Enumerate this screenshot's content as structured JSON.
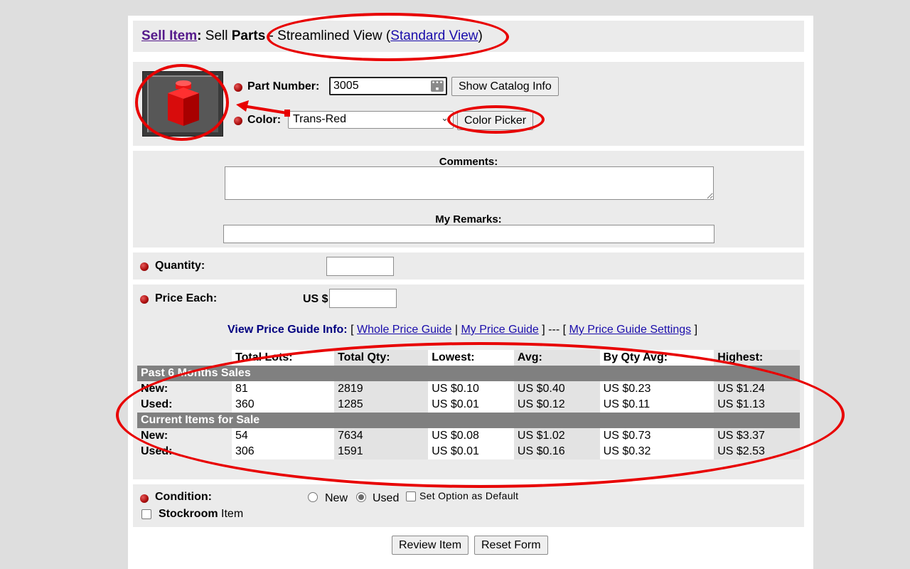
{
  "header": {
    "sell_item_link": "Sell Item",
    "colon": ":",
    "sell": "Sell",
    "parts": "Parts",
    "streamlined": "- Streamlined View (",
    "standard_view_link": "Standard View",
    "close_paren": ")"
  },
  "part": {
    "part_number_label": "Part Number:",
    "part_number_value": "3005",
    "show_catalog_button": "Show Catalog Info",
    "color_label": "Color:",
    "color_value": "Trans-Red",
    "color_picker_button": "Color Picker",
    "image_icon": "red-1x1-brick-icon"
  },
  "comments": {
    "comments_label": "Comments:",
    "my_remarks_label": "My Remarks:",
    "comments_value": "",
    "my_remarks_value": ""
  },
  "quantity": {
    "label": "Quantity:",
    "value": ""
  },
  "price": {
    "label": "Price Each:",
    "currency": "US $",
    "value": "",
    "guide_label": "View Price Guide Info:",
    "open_bracket": "[",
    "whole_price_guide": "Whole Price Guide",
    "sep": "|",
    "my_price_guide": "My Price Guide",
    "mid_sep": "] --- [",
    "my_price_guide_settings": "My Price Guide Settings",
    "close_bracket": "]"
  },
  "price_table": {
    "columns": [
      "Total Lots:",
      "Total Qty:",
      "Lowest:",
      "Avg:",
      "By Qty Avg:",
      "Highest:"
    ],
    "sections": [
      {
        "title": "Past 6 Months Sales",
        "rows": [
          {
            "label": "New:",
            "values": [
              "81",
              "2819",
              "US $0.10",
              "US $0.40",
              "US $0.23",
              "US $1.24"
            ]
          },
          {
            "label": "Used:",
            "values": [
              "360",
              "1285",
              "US $0.01",
              "US $0.12",
              "US $0.11",
              "US $1.13"
            ]
          }
        ]
      },
      {
        "title": "Current Items for Sale",
        "rows": [
          {
            "label": "New:",
            "values": [
              "54",
              "7634",
              "US $0.08",
              "US $1.02",
              "US $0.73",
              "US $3.37"
            ]
          },
          {
            "label": "Used:",
            "values": [
              "306",
              "1591",
              "US $0.01",
              "US $0.16",
              "US $0.32",
              "US $2.53"
            ]
          }
        ]
      }
    ]
  },
  "condition": {
    "label": "Condition:",
    "new": "New",
    "used": "Used",
    "selected": "Used",
    "set_default": "Set Option as Default",
    "stockroom_bold": "Stockroom",
    "stockroom_rest": " Item"
  },
  "actions": {
    "review": "Review Item",
    "reset": "Reset Form"
  },
  "colors": {
    "annotation": "#e80000",
    "section_bar": "#808080",
    "panel": "#ebebeb",
    "link": "#1a0dab",
    "visited_link": "#551a8b",
    "guide_label": "#000080"
  }
}
